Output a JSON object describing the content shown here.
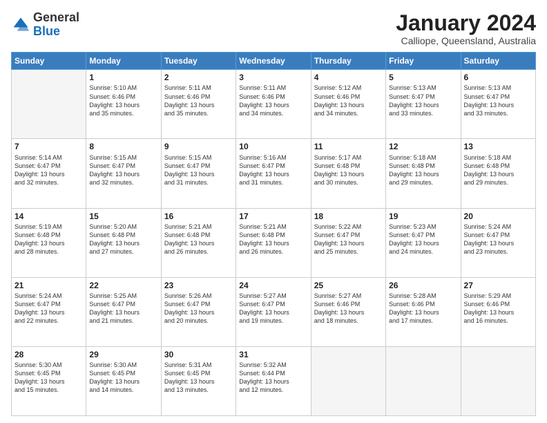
{
  "header": {
    "logo_general": "General",
    "logo_blue": "Blue",
    "month_year": "January 2024",
    "location": "Calliope, Queensland, Australia"
  },
  "days": [
    "Sunday",
    "Monday",
    "Tuesday",
    "Wednesday",
    "Thursday",
    "Friday",
    "Saturday"
  ],
  "weeks": [
    [
      {
        "day": "",
        "info": ""
      },
      {
        "day": "1",
        "info": "Sunrise: 5:10 AM\nSunset: 6:46 PM\nDaylight: 13 hours\nand 35 minutes."
      },
      {
        "day": "2",
        "info": "Sunrise: 5:11 AM\nSunset: 6:46 PM\nDaylight: 13 hours\nand 35 minutes."
      },
      {
        "day": "3",
        "info": "Sunrise: 5:11 AM\nSunset: 6:46 PM\nDaylight: 13 hours\nand 34 minutes."
      },
      {
        "day": "4",
        "info": "Sunrise: 5:12 AM\nSunset: 6:46 PM\nDaylight: 13 hours\nand 34 minutes."
      },
      {
        "day": "5",
        "info": "Sunrise: 5:13 AM\nSunset: 6:47 PM\nDaylight: 13 hours\nand 33 minutes."
      },
      {
        "day": "6",
        "info": "Sunrise: 5:13 AM\nSunset: 6:47 PM\nDaylight: 13 hours\nand 33 minutes."
      }
    ],
    [
      {
        "day": "7",
        "info": "Sunrise: 5:14 AM\nSunset: 6:47 PM\nDaylight: 13 hours\nand 32 minutes."
      },
      {
        "day": "8",
        "info": "Sunrise: 5:15 AM\nSunset: 6:47 PM\nDaylight: 13 hours\nand 32 minutes."
      },
      {
        "day": "9",
        "info": "Sunrise: 5:15 AM\nSunset: 6:47 PM\nDaylight: 13 hours\nand 31 minutes."
      },
      {
        "day": "10",
        "info": "Sunrise: 5:16 AM\nSunset: 6:47 PM\nDaylight: 13 hours\nand 31 minutes."
      },
      {
        "day": "11",
        "info": "Sunrise: 5:17 AM\nSunset: 6:48 PM\nDaylight: 13 hours\nand 30 minutes."
      },
      {
        "day": "12",
        "info": "Sunrise: 5:18 AM\nSunset: 6:48 PM\nDaylight: 13 hours\nand 29 minutes."
      },
      {
        "day": "13",
        "info": "Sunrise: 5:18 AM\nSunset: 6:48 PM\nDaylight: 13 hours\nand 29 minutes."
      }
    ],
    [
      {
        "day": "14",
        "info": "Sunrise: 5:19 AM\nSunset: 6:48 PM\nDaylight: 13 hours\nand 28 minutes."
      },
      {
        "day": "15",
        "info": "Sunrise: 5:20 AM\nSunset: 6:48 PM\nDaylight: 13 hours\nand 27 minutes."
      },
      {
        "day": "16",
        "info": "Sunrise: 5:21 AM\nSunset: 6:48 PM\nDaylight: 13 hours\nand 26 minutes."
      },
      {
        "day": "17",
        "info": "Sunrise: 5:21 AM\nSunset: 6:48 PM\nDaylight: 13 hours\nand 26 minutes."
      },
      {
        "day": "18",
        "info": "Sunrise: 5:22 AM\nSunset: 6:47 PM\nDaylight: 13 hours\nand 25 minutes."
      },
      {
        "day": "19",
        "info": "Sunrise: 5:23 AM\nSunset: 6:47 PM\nDaylight: 13 hours\nand 24 minutes."
      },
      {
        "day": "20",
        "info": "Sunrise: 5:24 AM\nSunset: 6:47 PM\nDaylight: 13 hours\nand 23 minutes."
      }
    ],
    [
      {
        "day": "21",
        "info": "Sunrise: 5:24 AM\nSunset: 6:47 PM\nDaylight: 13 hours\nand 22 minutes."
      },
      {
        "day": "22",
        "info": "Sunrise: 5:25 AM\nSunset: 6:47 PM\nDaylight: 13 hours\nand 21 minutes."
      },
      {
        "day": "23",
        "info": "Sunrise: 5:26 AM\nSunset: 6:47 PM\nDaylight: 13 hours\nand 20 minutes."
      },
      {
        "day": "24",
        "info": "Sunrise: 5:27 AM\nSunset: 6:47 PM\nDaylight: 13 hours\nand 19 minutes."
      },
      {
        "day": "25",
        "info": "Sunrise: 5:27 AM\nSunset: 6:46 PM\nDaylight: 13 hours\nand 18 minutes."
      },
      {
        "day": "26",
        "info": "Sunrise: 5:28 AM\nSunset: 6:46 PM\nDaylight: 13 hours\nand 17 minutes."
      },
      {
        "day": "27",
        "info": "Sunrise: 5:29 AM\nSunset: 6:46 PM\nDaylight: 13 hours\nand 16 minutes."
      }
    ],
    [
      {
        "day": "28",
        "info": "Sunrise: 5:30 AM\nSunset: 6:45 PM\nDaylight: 13 hours\nand 15 minutes."
      },
      {
        "day": "29",
        "info": "Sunrise: 5:30 AM\nSunset: 6:45 PM\nDaylight: 13 hours\nand 14 minutes."
      },
      {
        "day": "30",
        "info": "Sunrise: 5:31 AM\nSunset: 6:45 PM\nDaylight: 13 hours\nand 13 minutes."
      },
      {
        "day": "31",
        "info": "Sunrise: 5:32 AM\nSunset: 6:44 PM\nDaylight: 13 hours\nand 12 minutes."
      },
      {
        "day": "",
        "info": ""
      },
      {
        "day": "",
        "info": ""
      },
      {
        "day": "",
        "info": ""
      }
    ]
  ]
}
